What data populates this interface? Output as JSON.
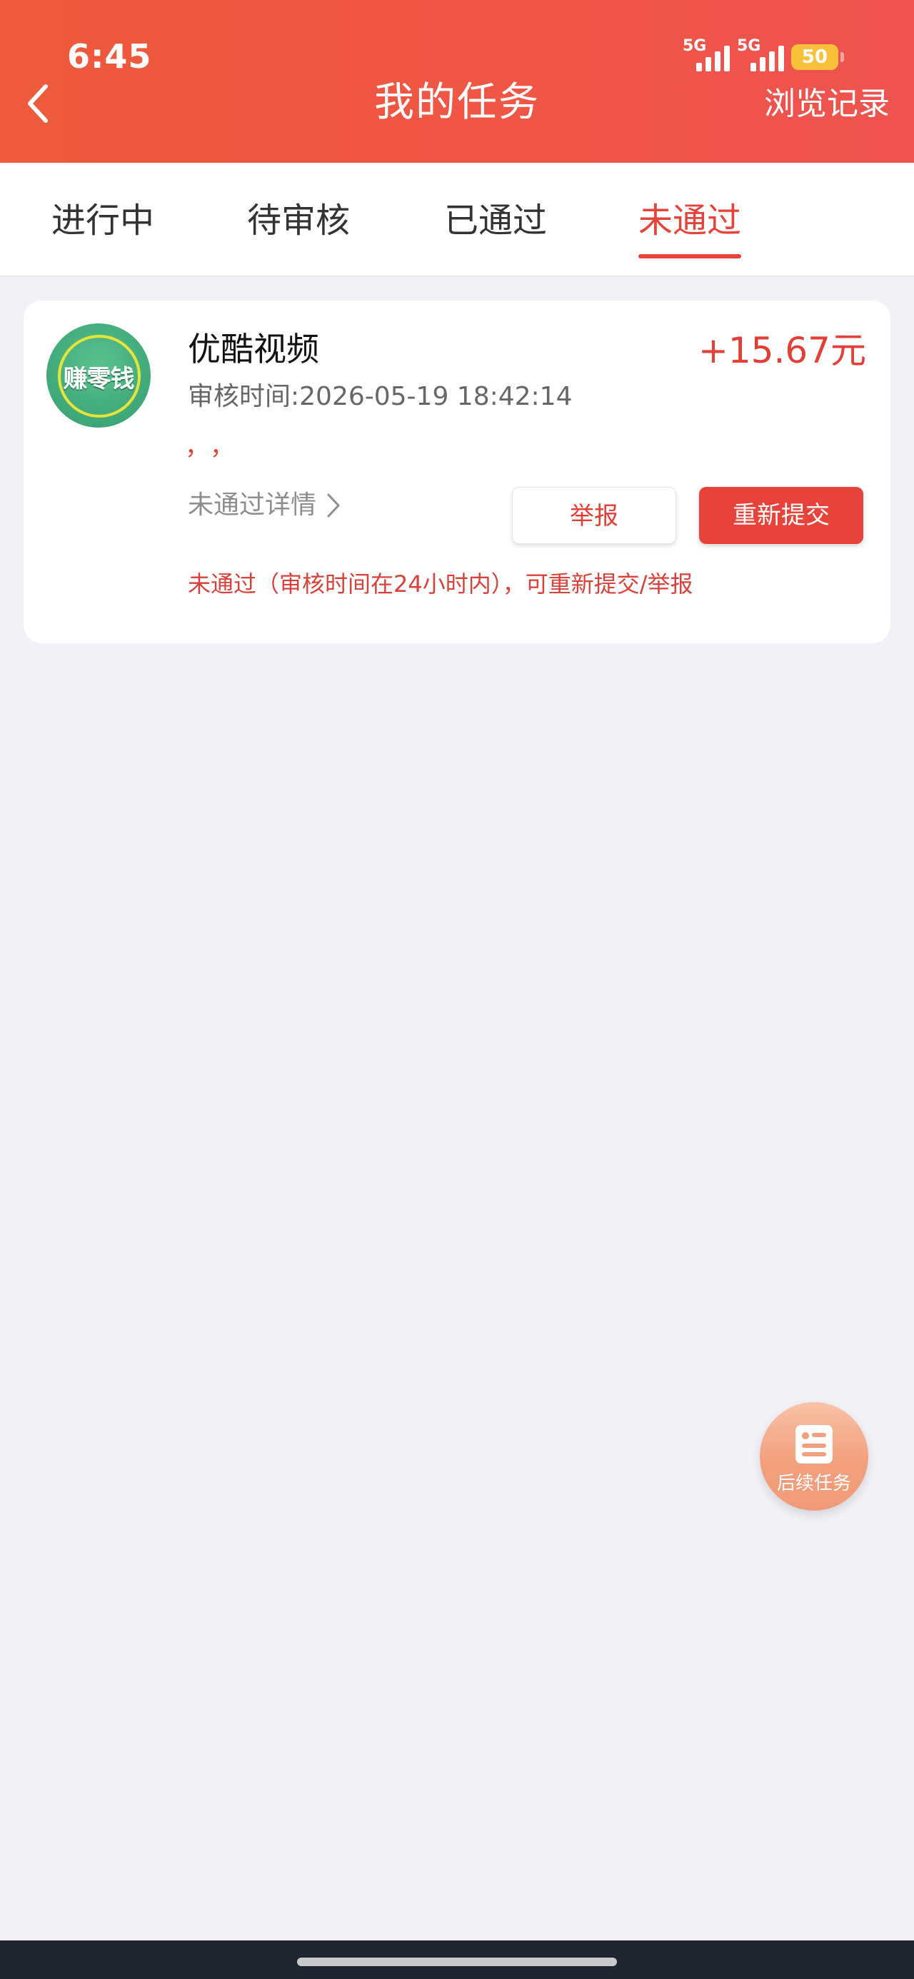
{
  "status_bar": {
    "time": "6:45",
    "signal1_label": "5G",
    "signal2_label": "5G",
    "battery": "50"
  },
  "header": {
    "title": "我的任务",
    "history_label": "浏览记录"
  },
  "tabs": [
    {
      "label": "进行中",
      "active": false
    },
    {
      "label": "待审核",
      "active": false
    },
    {
      "label": "已通过",
      "active": false
    },
    {
      "label": "未通过",
      "active": true
    }
  ],
  "task": {
    "logo_text": "赚零钱",
    "name": "优酷视频",
    "reward": "+15.67元",
    "review_time_label": "审核时间:",
    "review_time_value": "2026-05-19 18:42:14",
    "note": "，，",
    "detail_link": "未通过详情",
    "report_button": "举报",
    "resubmit_button": "重新提交",
    "fail_note": "未通过（审核时间在24小时内），可重新提交/举报"
  },
  "floating": {
    "label": "后续任务"
  },
  "colors": {
    "accent": "#e8433a",
    "header_start": "#ee5a3b",
    "header_end": "#ee5350",
    "background": "#f1f1f7"
  }
}
